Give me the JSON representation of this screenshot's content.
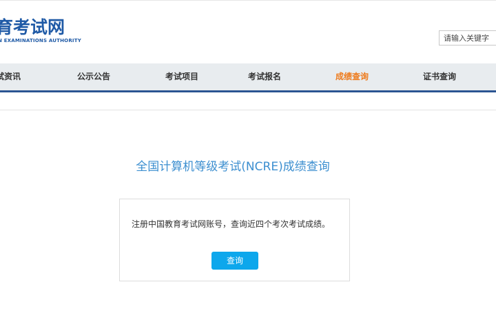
{
  "header": {
    "logo_text": "育考试网",
    "logo_subtext": "N EXAMINATIONS AUTHORITY",
    "search_placeholder": "请输入关键字"
  },
  "nav": {
    "items": [
      {
        "label": "试资讯",
        "active": false
      },
      {
        "label": "公示公告",
        "active": false
      },
      {
        "label": "考试项目",
        "active": false
      },
      {
        "label": "考试报名",
        "active": false
      },
      {
        "label": "成绩查询",
        "active": true
      },
      {
        "label": "证书查询",
        "active": false
      }
    ]
  },
  "main": {
    "title": "全国计算机等级考试(NCRE)成绩查询",
    "notice": "注册中国教育考试网账号，查询近四个考次考试成绩。",
    "query_button": "查询"
  },
  "colors": {
    "brand_blue": "#1f5aa6",
    "nav_bg": "#e8ecef",
    "nav_active": "#ee7a1b",
    "title_blue": "#3d8fd0",
    "button_blue": "#0da7ec"
  }
}
